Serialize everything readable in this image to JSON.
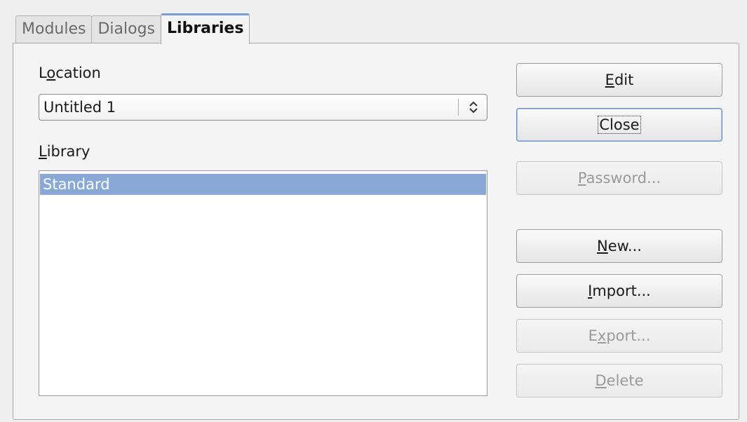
{
  "tabs": [
    {
      "label": "Modules",
      "active": false
    },
    {
      "label": "Dialogs",
      "active": false
    },
    {
      "label": "Libraries",
      "active": true
    }
  ],
  "location": {
    "label_pre": "L",
    "label_mnemonic": "o",
    "label_post": "cation",
    "selected": "Untitled 1"
  },
  "library": {
    "label_mnemonic": "L",
    "label_post": "ibrary",
    "items": [
      "Standard"
    ],
    "selected_index": 0
  },
  "buttons": {
    "edit": {
      "mnemonic": "E",
      "rest": "dit",
      "enabled": true
    },
    "close": {
      "label": "Close",
      "enabled": true,
      "focused": true
    },
    "password": {
      "mnemonic": "P",
      "rest": "assword...",
      "enabled": false
    },
    "new": {
      "mnemonic": "N",
      "rest": "ew...",
      "enabled": true
    },
    "import": {
      "mnemonic": "I",
      "rest": "mport...",
      "enabled": true
    },
    "export": {
      "pre": "E",
      "mnemonic": "x",
      "rest": "port...",
      "enabled": false
    },
    "delete": {
      "mnemonic": "D",
      "rest": "elete",
      "enabled": false
    }
  },
  "colors": {
    "selection": "#88a9d8",
    "active_tab_accent": "#7a9fd2"
  }
}
